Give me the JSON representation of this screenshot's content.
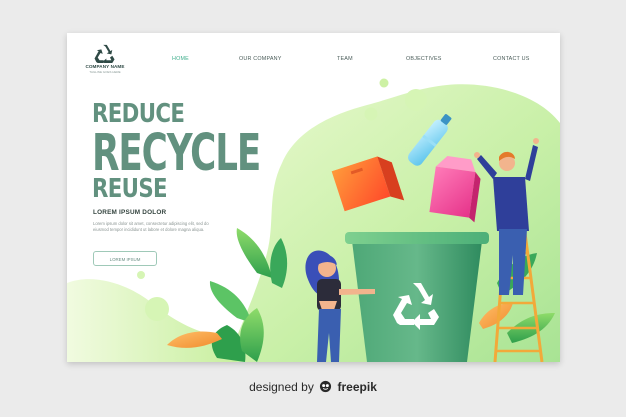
{
  "header": {
    "company_name": "COMPANY NAME",
    "company_tagline": "TAGLINE GOES HERE",
    "logo_icon": "recycle-icon",
    "nav": [
      {
        "label": "HOME",
        "active": true
      },
      {
        "label": "OUR COMPANY",
        "active": false
      },
      {
        "label": "TEAM",
        "active": false
      },
      {
        "label": "OBJECTIVES",
        "active": false
      },
      {
        "label": "CONTACT US",
        "active": false
      }
    ]
  },
  "hero": {
    "line1": "REDUCE",
    "line2": "RECYCLE",
    "line3": "REUSE",
    "subheading": "LOREM IPSUM DOLOR",
    "body": "Lorem ipsum dolor sit amet, consectetur adipiscing elit, sed do eiusmod tempor incididunt ut labore et dolore magna aliqua.",
    "button_label": "LOREM IPSUM"
  },
  "illustration": {
    "bin_icon": "recycle-icon",
    "items": [
      "orange-box",
      "plastic-bottle",
      "milk-carton"
    ]
  },
  "colors": {
    "accent": "#3fae8c",
    "headline": "#62917f",
    "bin": "#3e9d6e",
    "blob_light": "#dff5c6",
    "blob_mid": "#b6e89c"
  },
  "credit": {
    "prefix": "designed by",
    "brand": "freepik"
  }
}
